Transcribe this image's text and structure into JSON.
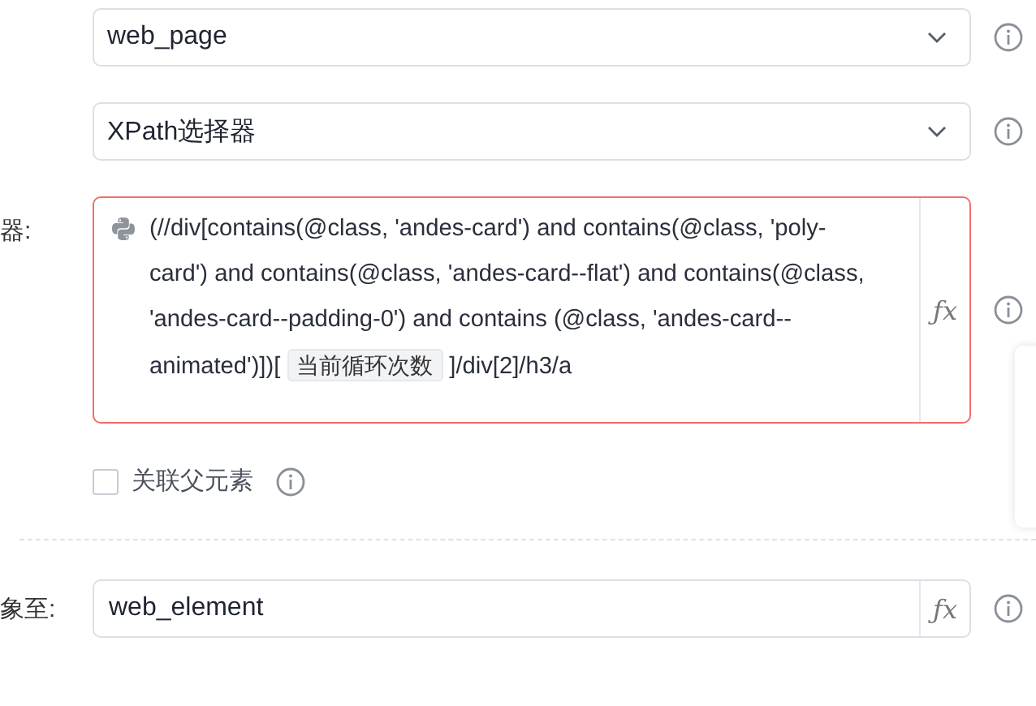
{
  "rows": [
    {
      "kind": "select",
      "value": "web_page"
    },
    {
      "kind": "select",
      "value": "XPath选择器"
    },
    {
      "kind": "expression",
      "label": "器:",
      "invalid": true,
      "fx": "ƒx",
      "parts": [
        {
          "kind": "text",
          "text": "(//div[contains(@class, 'andes-card') and contains(@class, 'poly-card') and contains(@class, 'andes-card--flat') and contains(@class, 'andes-card--padding-0') and contains (@class, 'andes-card--animated')])["
        },
        {
          "kind": "variable",
          "text": "当前循环次数"
        },
        {
          "kind": "text",
          "text": "]/div[2]/h3/a"
        }
      ]
    },
    {
      "kind": "checkbox",
      "label": "关联父元素",
      "checked": false
    },
    {
      "kind": "divider"
    },
    {
      "kind": "input",
      "label": "象至:",
      "value": "web_element",
      "fx": "ƒx"
    }
  ]
}
